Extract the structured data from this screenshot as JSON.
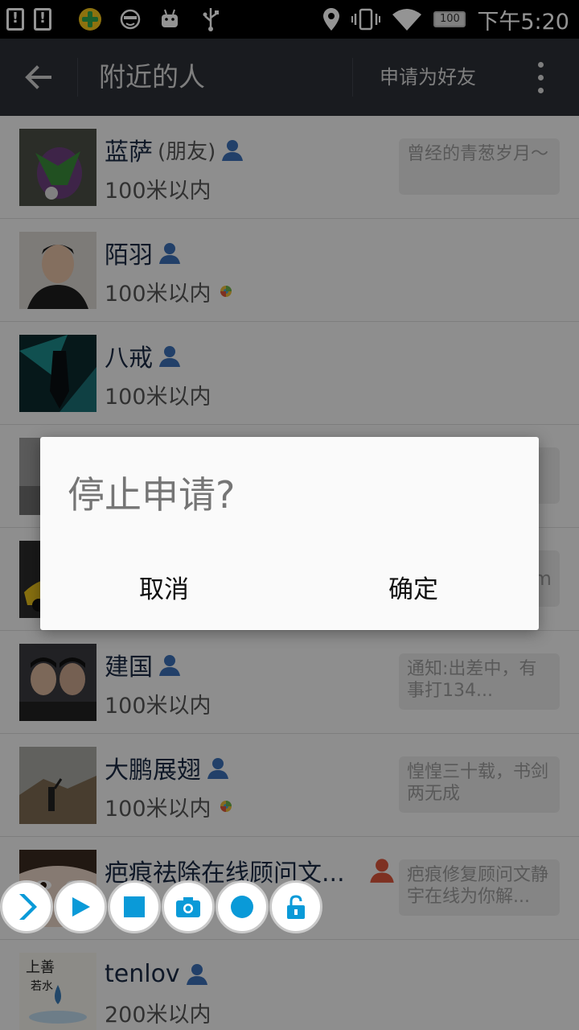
{
  "status_bar": {
    "time": "下午5:20",
    "battery": "100",
    "notif_icons": [
      "!",
      "!"
    ]
  },
  "action_bar": {
    "title": "附近的人",
    "action_label": "申请为好友"
  },
  "people": [
    {
      "name": "蓝萨",
      "friend_tag": "(朋友)",
      "distance": "100米以内",
      "signature": "曾经的青葱岁月～",
      "badge": false,
      "gender_color": "#3b6fb6"
    },
    {
      "name": "陌羽",
      "friend_tag": "",
      "distance": "100米以内",
      "signature": "",
      "badge": true,
      "gender_color": "#3b6fb6"
    },
    {
      "name": "八戒",
      "friend_tag": "",
      "distance": "100米以内",
      "signature": "",
      "badge": false,
      "gender_color": "#3b6fb6"
    },
    {
      "name": "",
      "friend_tag": "",
      "distance": "",
      "signature": "",
      "badge": false,
      "gender_color": "#3b6fb6"
    },
    {
      "name": "",
      "friend_tag": "",
      "distance": "",
      "signature": "m",
      "badge": false,
      "gender_color": "#3b6fb6"
    },
    {
      "name": "建国",
      "friend_tag": "",
      "distance": "100米以内",
      "signature": "通知:出差中，有事打134...",
      "badge": false,
      "gender_color": "#3b6fb6"
    },
    {
      "name": "大鹏展翅",
      "friend_tag": "",
      "distance": "100米以内",
      "signature": "惶惶三十载，书剑两无成",
      "badge": true,
      "gender_color": "#3b6fb6"
    },
    {
      "name": "疤痕祛除在线顾问文...",
      "friend_tag": "",
      "distance": "",
      "signature": "疤痕修复顾问文静宇在线为你解...",
      "badge": false,
      "gender_color": "#d9553b"
    },
    {
      "name": "tenlov",
      "friend_tag": "",
      "distance": "200米以内",
      "signature": "",
      "badge": false,
      "gender_color": "#3b6fb6"
    }
  ],
  "dialog": {
    "title": "停止申请?",
    "cancel_label": "取消",
    "ok_label": "确定"
  },
  "recorder_toolbar": {
    "buttons": [
      "expand-icon",
      "play-icon",
      "stop-icon",
      "camera-icon",
      "record-icon",
      "unlock-icon"
    ],
    "accent": "#0a9ad8"
  },
  "colors": {
    "action_bar_bg": "#2b2f36",
    "male_icon": "#3b6fb6",
    "female_icon": "#d9553b"
  }
}
